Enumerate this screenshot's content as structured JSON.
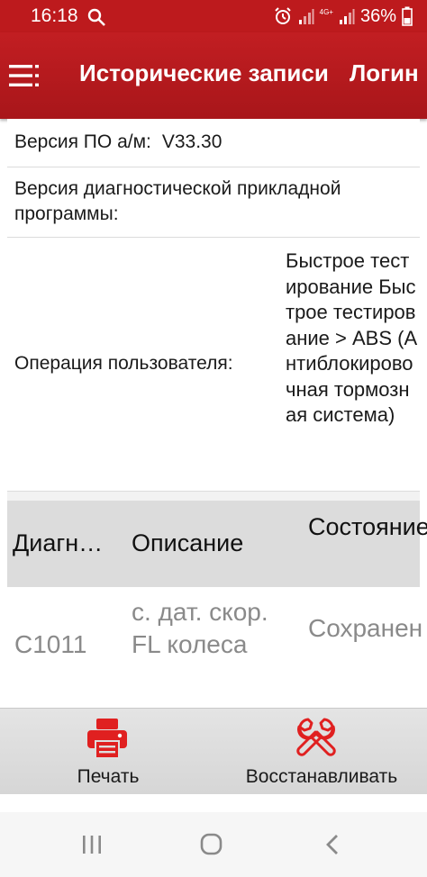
{
  "status_bar": {
    "time": "16:18",
    "battery_percent": "36%",
    "network_label": "4G+",
    "icons": [
      "search-icon",
      "alarm-icon",
      "signal-icon",
      "signal-icon",
      "battery-icon"
    ]
  },
  "app_bar": {
    "title": "Исторические записи",
    "login_label": "Логин",
    "menu_icon": "hamburger-menu-icon",
    "color": "#bd1a1d"
  },
  "info": {
    "sw_version_label": "Версия ПО а/м:",
    "sw_version_value": "V33.30",
    "diag_app_version_label": "Версия диагностической прикладной программы:",
    "user_operation_label": "Операция пользователя:",
    "user_operation_value": "Быстрое тестирование Быстрое тестирование > ABS (Антиблокировочная тормозная система)"
  },
  "table": {
    "headers": [
      "Диагн…",
      "Описание",
      "Состояние"
    ],
    "rows": [
      {
        "code": "C1011",
        "description": "с. дат. скор. FL колеса",
        "status": "Сохранен"
      }
    ]
  },
  "toolbar": {
    "print_label": "Печать",
    "restore_label": "Восстанавливать",
    "accent": "#e02020"
  },
  "navbar": {
    "icons": [
      "recents-icon",
      "home-icon",
      "back-icon"
    ]
  }
}
